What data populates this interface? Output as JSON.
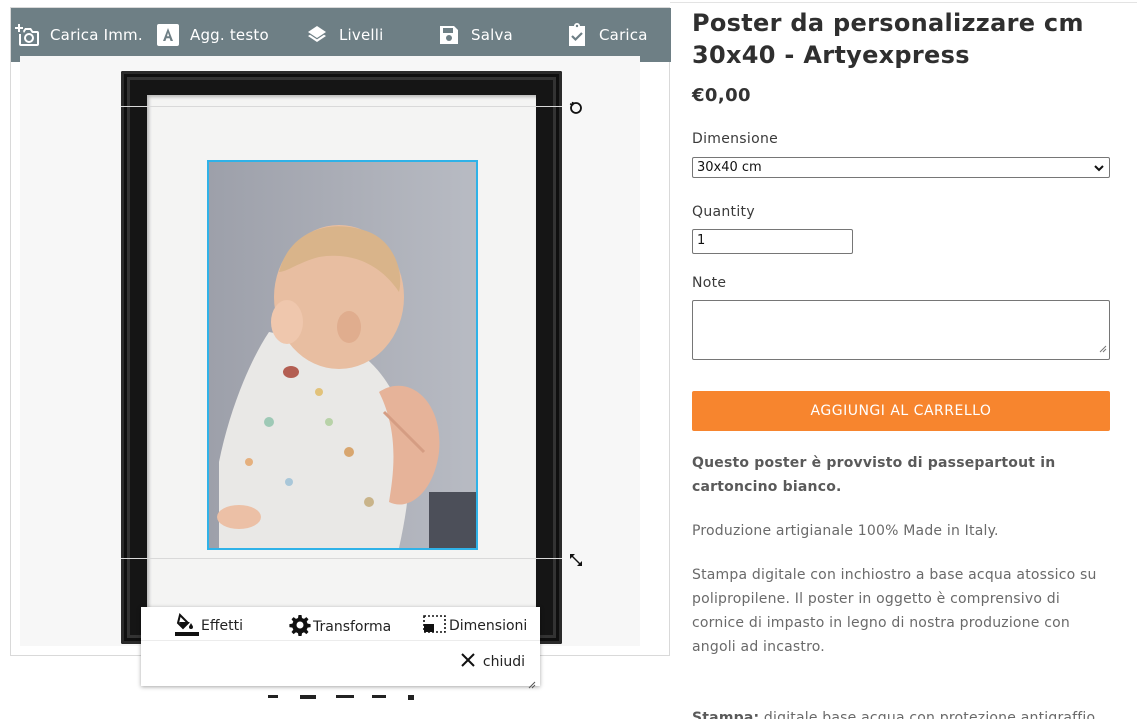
{
  "toolbar": {
    "items": [
      {
        "label": "Carica Imm.",
        "icon": "add-photo-icon"
      },
      {
        "label": "Agg. testo",
        "icon": "text-icon"
      },
      {
        "label": "Livelli",
        "icon": "layers-icon"
      },
      {
        "label": "Salva",
        "icon": "save-icon"
      },
      {
        "label": "Carica",
        "icon": "clipboard-check-icon"
      }
    ],
    "bg_color": "#6e7f85"
  },
  "panel": {
    "tabs": [
      {
        "label": "Effetti",
        "icon": "paint-bucket-icon"
      },
      {
        "label": "Transforma",
        "icon": "gear-icon"
      },
      {
        "label": "Dimensioni",
        "icon": "resize-icon"
      }
    ],
    "close_label": "chiudi"
  },
  "product": {
    "title": "Poster da personalizzare cm 30x40 - Artyexpress",
    "price": "€0,00",
    "dimension_label": "Dimensione",
    "dimension_value": "30x40 cm",
    "quantity_label": "Quantity",
    "quantity_value": "1",
    "note_label": "Note",
    "note_value": "",
    "add_to_cart": "AGGIUNGI AL CARRELLO",
    "desc_bold": "Questo poster è provvisto di passepartout in cartoncino bianco.",
    "desc_1": "Produzione artigianale 100% Made in Italy.",
    "desc_2": "Stampa digitale con inchiostro a base acqua atossico su polipropilene. Il poster in oggetto è comprensivo di cornice di impasto in legno di nostra produzione con angoli ad incastro.",
    "desc_3_bold": "Stampa:",
    "desc_3": " digitale base acqua con protezione antigraffio in"
  },
  "colors": {
    "accent": "#f7852e",
    "selection": "#2fb2e8"
  }
}
